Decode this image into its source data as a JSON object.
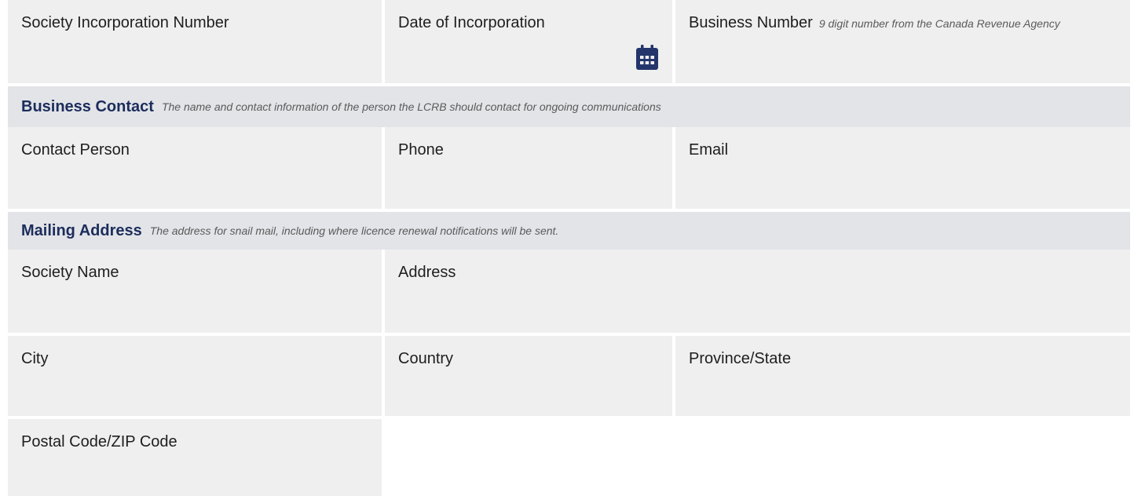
{
  "row1": {
    "incorporation_number_label": "Society Incorporation Number",
    "date_of_incorporation_label": "Date of Incorporation",
    "business_number_label": "Business Number",
    "business_number_hint": "9 digit number from the Canada Revenue Agency",
    "calendar_icon": "calendar-icon"
  },
  "business_contact": {
    "title": "Business Contact",
    "hint": "The name and contact information of the person the LCRB should contact for ongoing communications",
    "contact_person_label": "Contact Person",
    "phone_label": "Phone",
    "email_label": "Email"
  },
  "mailing_address": {
    "title": "Mailing Address",
    "hint": "The address for snail mail, including where licence renewal notifications will be sent.",
    "society_name_label": "Society Name",
    "address_label": "Address",
    "city_label": "City",
    "country_label": "Country",
    "province_label": "Province/State",
    "postal_code_label": "Postal Code/ZIP Code"
  },
  "colors": {
    "field_background": "#efefef",
    "header_background": "#e3e4e8",
    "header_title": "#1b2d5b",
    "icon": "#23356b"
  }
}
